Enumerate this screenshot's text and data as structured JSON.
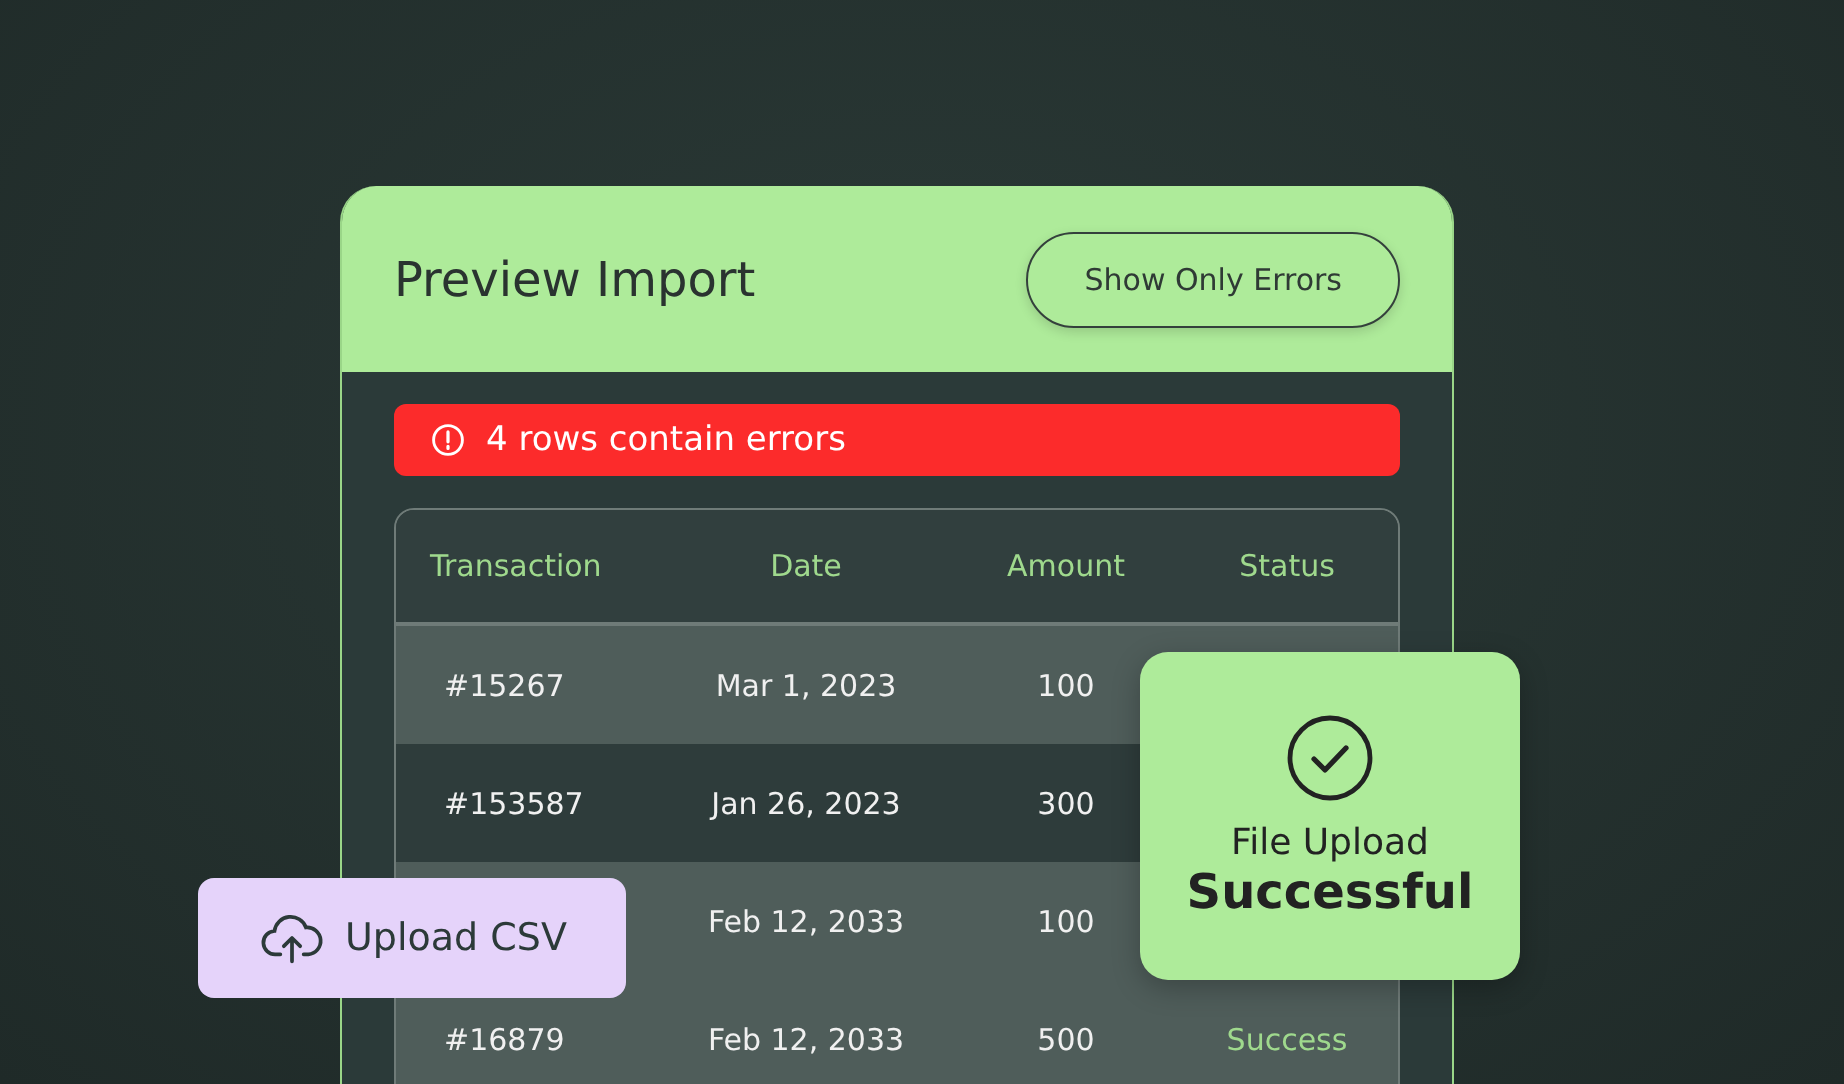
{
  "card": {
    "title": "Preview Import",
    "filter_button": "Show Only Errors"
  },
  "alert": {
    "message": "4 rows contain errors"
  },
  "table": {
    "columns": [
      "Transaction",
      "Date",
      "Amount",
      "Status"
    ],
    "rows": [
      {
        "cells": [
          "#15267",
          "Mar 1, 2023",
          "100",
          ""
        ],
        "selected": false
      },
      {
        "cells": [
          "#153587",
          "Jan 26, 2023",
          "300",
          ""
        ],
        "selected": true
      },
      {
        "cells": [
          "",
          "Feb 12, 2033",
          "100",
          ""
        ],
        "selected": false
      },
      {
        "cells": [
          "#16879",
          "Feb 12, 2033",
          "500",
          "Success"
        ],
        "selected": false
      }
    ]
  },
  "upload_button": {
    "label": "Upload CSV"
  },
  "toast": {
    "line_1": "File Upload",
    "line_2": "Successful"
  }
}
